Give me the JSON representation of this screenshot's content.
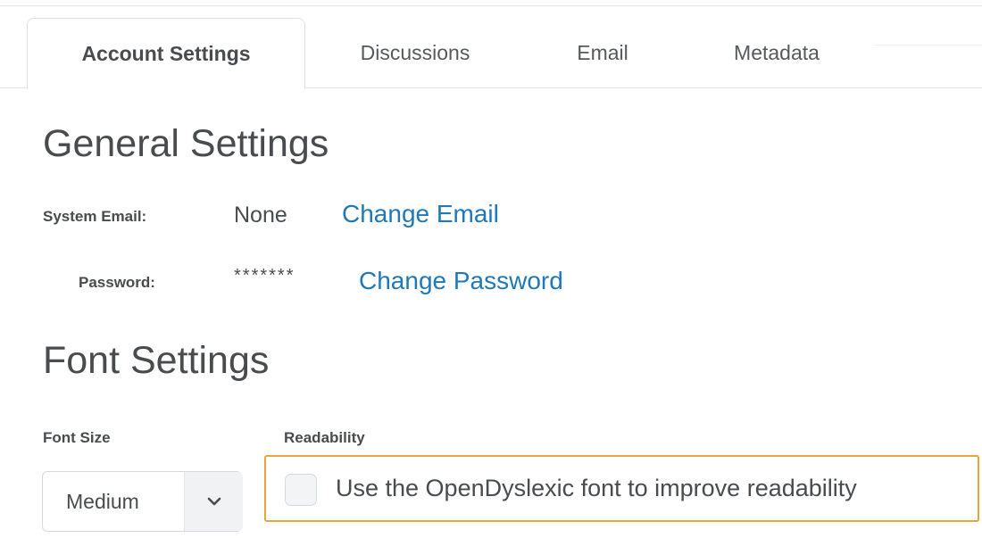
{
  "tabs": [
    {
      "label": "Account Settings",
      "active": true
    },
    {
      "label": "Discussions",
      "active": false
    },
    {
      "label": "Email",
      "active": false
    },
    {
      "label": "Metadata",
      "active": false
    }
  ],
  "general": {
    "heading": "General Settings",
    "email_label": "System Email:",
    "email_value": "None",
    "email_link": "Change Email",
    "password_label": "Password:",
    "password_value": "*******",
    "password_link": "Change Password"
  },
  "font": {
    "heading": "Font Settings",
    "size_label": "Font Size",
    "size_value": "Medium",
    "readability_label": "Readability",
    "readability_option": "Use the OpenDyslexic font to improve readability",
    "readability_checked": false
  },
  "colors": {
    "link": "#1f79b8",
    "focus_outline": "#e9a53b",
    "text": "#494c4e"
  }
}
